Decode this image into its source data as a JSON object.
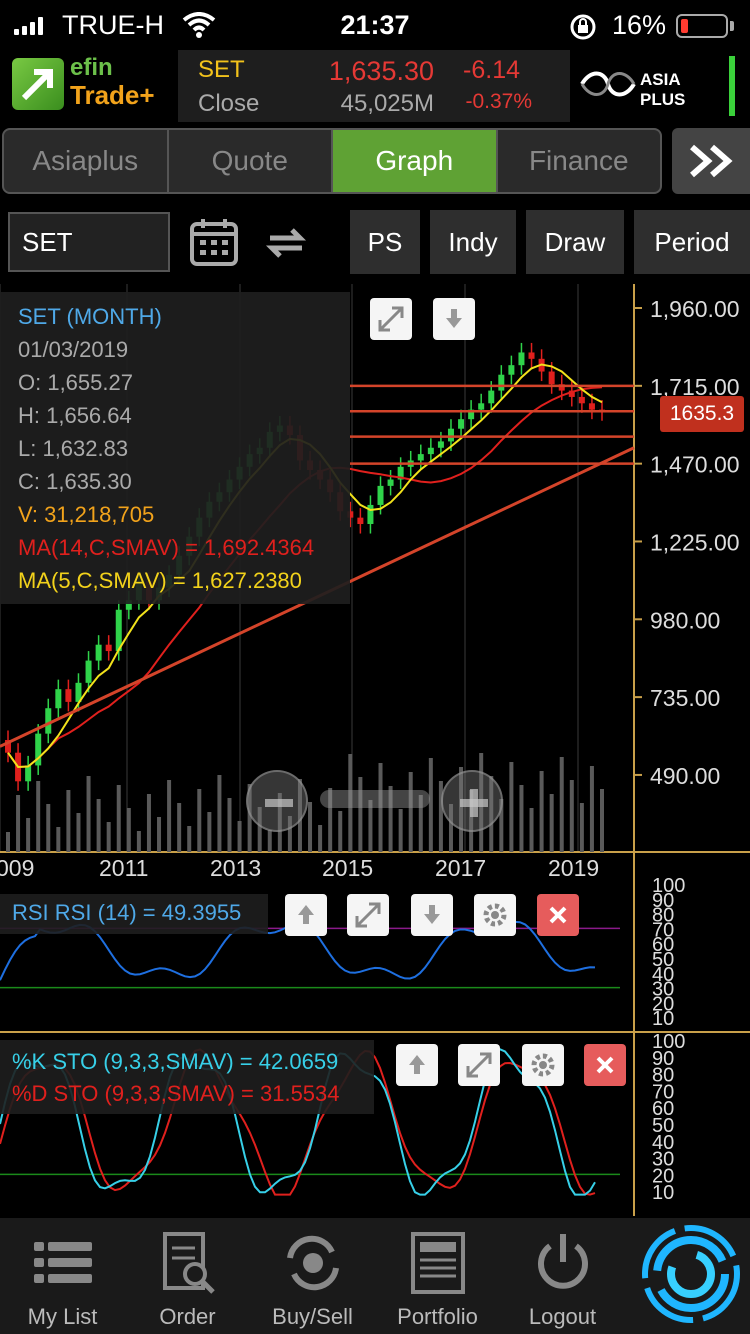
{
  "status_bar": {
    "carrier": "TRUE-H",
    "time": "21:37",
    "battery_pct": "16%",
    "battery_level": 0.16
  },
  "header": {
    "logo_top": "efin",
    "logo_bottom": "Trade+",
    "symbol": "SET",
    "close_label": "Close",
    "price": "1,635.30",
    "change": "-6.14",
    "volume": "45,025M",
    "change_pct": "-0.37%",
    "broker": "ASIA PLUS",
    "colors": {
      "up": "#3bd13b",
      "down": "#e53935",
      "symbol": "#f2c21b"
    }
  },
  "tabs": [
    {
      "label": "Asiaplus",
      "active": false
    },
    {
      "label": "Quote",
      "active": false
    },
    {
      "label": "Graph",
      "active": true
    },
    {
      "label": "Finance",
      "active": false
    }
  ],
  "toolbar": {
    "symbol_value": "SET",
    "buttons": [
      "PS",
      "Indy",
      "Draw",
      "Period"
    ]
  },
  "chart_info": {
    "title": "SET (MONTH)",
    "date": "01/03/2019",
    "open": "O: 1,655.27",
    "high": "H: 1,656.64",
    "low": "L: 1,632.83",
    "close": "C: 1,635.30",
    "volume": "V: 31,218,705",
    "ma14": "MA(14,C,SMAV) = 1,692.4364",
    "ma5": "MA(5,C,SMAV) = 1,627.2380",
    "last_price_tag": "1635.3"
  },
  "rsi": {
    "label": "RSI RSI (14) = 49.3955",
    "ticks": [
      "100",
      "90",
      "80",
      "70",
      "60",
      "50",
      "40",
      "30",
      "20",
      "10"
    ]
  },
  "sto": {
    "k_label": "%K STO (9,3,3,SMAV) = 42.0659",
    "d_label": "%D STO (9,3,3,SMAV) = 31.5534",
    "ticks": [
      "100",
      "90",
      "80",
      "70",
      "60",
      "50",
      "40",
      "30",
      "20",
      "10"
    ]
  },
  "chart_data": {
    "type": "candlestick",
    "period": "monthly",
    "y_ticks": [
      "1,960.00",
      "1,715.00",
      "1,470.00",
      "1,225.00",
      "980.00",
      "735.00",
      "490.00"
    ],
    "ylim": [
      430,
      1960
    ],
    "x_tick_labels": [
      "009",
      "2011",
      "2013",
      "2015",
      "2017",
      "2019"
    ],
    "close_series": [
      560,
      470,
      520,
      620,
      700,
      760,
      720,
      780,
      850,
      900,
      880,
      1010,
      1040,
      1100,
      1040,
      1080,
      1120,
      1180,
      1240,
      1300,
      1350,
      1380,
      1420,
      1460,
      1500,
      1520,
      1570,
      1590,
      1560,
      1480,
      1450,
      1420,
      1380,
      1320,
      1300,
      1280,
      1340,
      1400,
      1420,
      1460,
      1480,
      1500,
      1520,
      1540,
      1580,
      1610,
      1640,
      1660,
      1700,
      1750,
      1780,
      1820,
      1800,
      1760,
      1720,
      1700,
      1680,
      1660,
      1640,
      1635
    ],
    "horizontal_levels": [
      1715,
      1635,
      1555,
      1470
    ],
    "trendline": {
      "from": [
        2009,
        580
      ],
      "to": [
        2019.3,
        1520
      ]
    },
    "rsi_current": 49.3955,
    "sto_k": 42.0659,
    "sto_d": 31.5534
  },
  "nav": [
    {
      "label": "My List",
      "icon": "list-icon"
    },
    {
      "label": "Order",
      "icon": "order-icon"
    },
    {
      "label": "Buy/Sell",
      "icon": "buysell-icon"
    },
    {
      "label": "Portfolio",
      "icon": "portfolio-icon"
    },
    {
      "label": "Logout",
      "icon": "power-icon"
    }
  ]
}
